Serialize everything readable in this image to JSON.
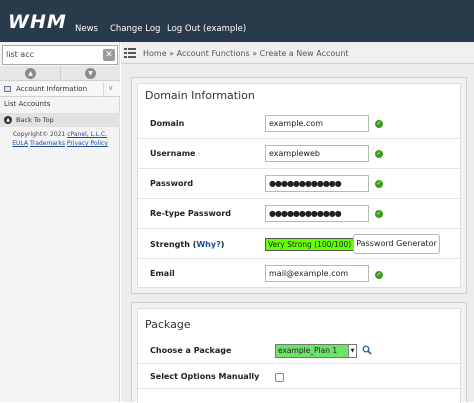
{
  "topbar": {
    "logo": "WHM",
    "nav": [
      "News",
      "Change Log",
      "Log Out (example)"
    ]
  },
  "sidebar": {
    "search_value": "list acc",
    "section_title": "Account Information",
    "items": [
      "List Accounts"
    ],
    "back_to_top": "Back To Top",
    "copyright": "Copyright© 2021",
    "cpanel_link": "cPanel, L.L.C.",
    "links": [
      "EULA",
      "Trademarks",
      "Privacy Policy"
    ]
  },
  "breadcrumb": {
    "home": "Home",
    "sep": "»",
    "section": "Account Functions",
    "page": "Create a New Account"
  },
  "domain_panel": {
    "title": "Domain Information",
    "domain_label": "Domain",
    "domain_value": "example.com",
    "username_label": "Username",
    "username_value": "exampleweb",
    "password_label": "Password",
    "password_value": "●●●●●●●●●●●●",
    "retype_label": "Re-type Password",
    "retype_value": "●●●●●●●●●●●●",
    "strength_label": "Strength",
    "strength_why": "Why?",
    "strength_value": "Very Strong (100/100)",
    "password_generator": "Password Generator",
    "email_label": "Email",
    "email_value": "mail@example.com"
  },
  "package_panel": {
    "title": "Package",
    "choose_label": "Choose a Package",
    "choose_value": "example_Plan 1",
    "manual_label": "Select Options Manually"
  },
  "colors": {
    "topbar": "#293a4a",
    "check": "#3c9a1e",
    "strength": "#66ff00",
    "package_select": "#6ee36a",
    "link": "#1a4f9c"
  }
}
